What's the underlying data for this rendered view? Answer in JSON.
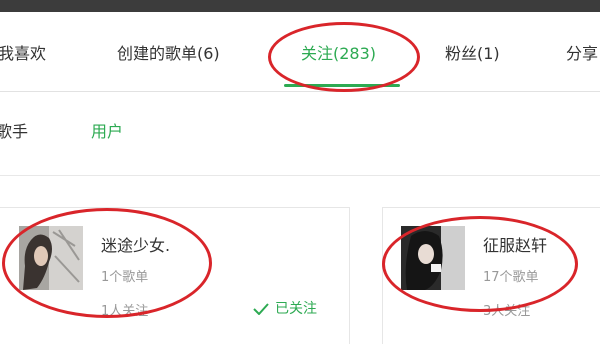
{
  "tabs": [
    {
      "label": "我喜欢"
    },
    {
      "label": "创建的歌单(6)"
    },
    {
      "label": "关注(283)",
      "active": true
    },
    {
      "label": "粉丝(1)"
    },
    {
      "label": "分享"
    }
  ],
  "subtabs": [
    {
      "label": "歌手"
    },
    {
      "label": "用户",
      "active": true
    }
  ],
  "users": [
    {
      "name": "迷途少女.",
      "playlists": "1个歌单",
      "followers": "1人关注",
      "status": "已关注"
    },
    {
      "name": "征服赵轩",
      "playlists": "17个歌单",
      "followers": "3人关注"
    }
  ],
  "colors": {
    "accent": "#2daa52",
    "annotation": "#d9252a",
    "topbar": "#3c3c3c"
  },
  "icons": {
    "follow_status": "check-icon"
  }
}
